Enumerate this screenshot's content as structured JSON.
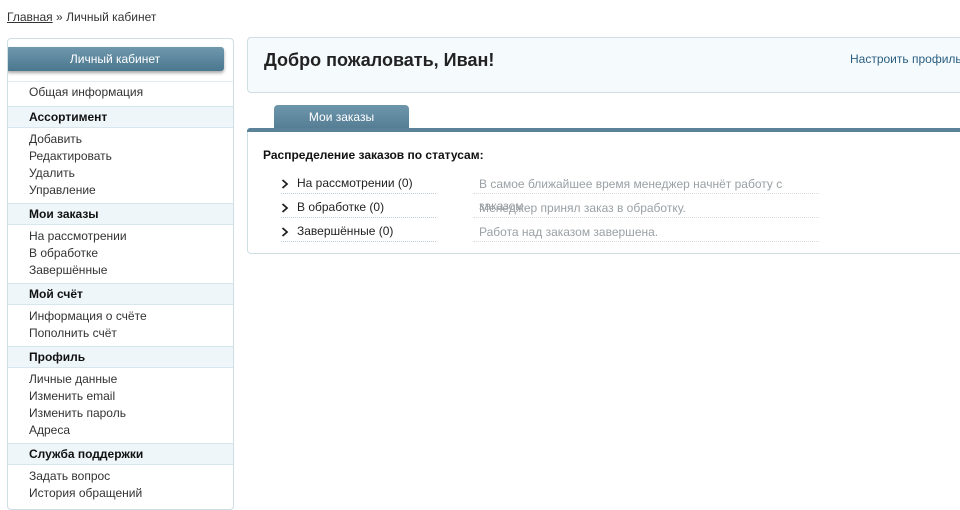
{
  "breadcrumb": {
    "home": "Главная",
    "separator": "»",
    "current": "Личный кабинет"
  },
  "sidebar": {
    "title": "Личный кабинет",
    "general": "Общая информация",
    "sections": [
      {
        "title": "Ассортимент",
        "items": [
          "Добавить",
          "Редактировать",
          "Удалить",
          "Управление"
        ]
      },
      {
        "title": "Мои заказы",
        "items": [
          "На рассмотрении",
          "В обработке",
          "Завершённые"
        ]
      },
      {
        "title": "Мой счёт",
        "items": [
          "Информация о счёте",
          "Пополнить счёт"
        ]
      },
      {
        "title": "Профиль",
        "items": [
          "Личные данные",
          "Изменить email",
          "Изменить пароль",
          "Адреса"
        ]
      },
      {
        "title": "Служба поддержки",
        "items": [
          "Задать вопрос",
          "История обращений"
        ]
      }
    ]
  },
  "welcome": {
    "text": "Добро пожаловать, Иван!",
    "profile_link": "Настроить профиль"
  },
  "orders": {
    "tab": "Мои заказы",
    "title": "Распределение заказов по статусам:",
    "statuses": [
      {
        "label": "На рассмотрении (0)",
        "description": "В самое ближайшее время менеджер начнёт работу с заказом."
      },
      {
        "label": "В обработке (0)",
        "description": "Менеджер принял заказ в обработку."
      },
      {
        "label": "Завершённые (0)",
        "description": "Работа над заказом завершена."
      }
    ]
  },
  "icons": {
    "status_row": "chevron-right-icon"
  }
}
